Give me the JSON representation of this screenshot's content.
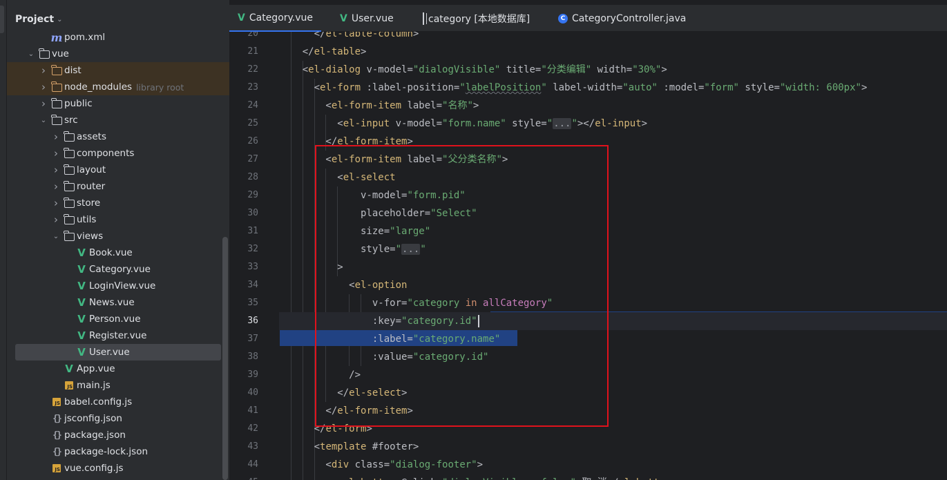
{
  "project": {
    "title": "Project",
    "tree": [
      {
        "label": "pom.xml",
        "icon": "maven-icon",
        "indent": 2,
        "arrow": "none"
      },
      {
        "label": "vue",
        "icon": "folder-icon",
        "indent": 1,
        "arrow": "down"
      },
      {
        "label": "dist",
        "icon": "folder-orange-icon",
        "indent": 2,
        "arrow": "right",
        "excluded": true
      },
      {
        "label": "node_modules",
        "hint": "library root",
        "icon": "folder-orange-icon",
        "indent": 2,
        "arrow": "right",
        "excluded": true
      },
      {
        "label": "public",
        "icon": "folder-icon",
        "indent": 2,
        "arrow": "right"
      },
      {
        "label": "src",
        "icon": "folder-icon",
        "indent": 2,
        "arrow": "down"
      },
      {
        "label": "assets",
        "icon": "folder-icon",
        "indent": 3,
        "arrow": "right"
      },
      {
        "label": "components",
        "icon": "folder-icon",
        "indent": 3,
        "arrow": "right"
      },
      {
        "label": "layout",
        "icon": "folder-icon",
        "indent": 3,
        "arrow": "right"
      },
      {
        "label": "router",
        "icon": "folder-icon",
        "indent": 3,
        "arrow": "right"
      },
      {
        "label": "store",
        "icon": "folder-icon",
        "indent": 3,
        "arrow": "right"
      },
      {
        "label": "utils",
        "icon": "folder-icon",
        "indent": 3,
        "arrow": "right"
      },
      {
        "label": "views",
        "icon": "folder-icon",
        "indent": 3,
        "arrow": "down"
      },
      {
        "label": "Book.vue",
        "icon": "vue-icon",
        "indent": 4,
        "arrow": "none"
      },
      {
        "label": "Category.vue",
        "icon": "vue-icon",
        "indent": 4,
        "arrow": "none"
      },
      {
        "label": "LoginView.vue",
        "icon": "vue-icon",
        "indent": 4,
        "arrow": "none"
      },
      {
        "label": "News.vue",
        "icon": "vue-icon",
        "indent": 4,
        "arrow": "none"
      },
      {
        "label": "Person.vue",
        "icon": "vue-icon",
        "indent": 4,
        "arrow": "none"
      },
      {
        "label": "Register.vue",
        "icon": "vue-icon",
        "indent": 4,
        "arrow": "none"
      },
      {
        "label": "User.vue",
        "icon": "vue-icon",
        "indent": 4,
        "arrow": "none",
        "selected": true
      },
      {
        "label": "App.vue",
        "icon": "vue-icon",
        "indent": 3,
        "arrow": "none"
      },
      {
        "label": "main.js",
        "icon": "js-icon",
        "indent": 3,
        "arrow": "none"
      },
      {
        "label": "babel.config.js",
        "icon": "js-icon",
        "indent": 2,
        "arrow": "none"
      },
      {
        "label": "jsconfig.json",
        "icon": "json-icon",
        "indent": 2,
        "arrow": "none"
      },
      {
        "label": "package.json",
        "icon": "json-icon",
        "indent": 2,
        "arrow": "none"
      },
      {
        "label": "package-lock.json",
        "icon": "json-icon",
        "indent": 2,
        "arrow": "none"
      },
      {
        "label": "vue.config.js",
        "icon": "js-icon",
        "indent": 2,
        "arrow": "none"
      }
    ]
  },
  "tabs": [
    {
      "label": "Category.vue",
      "icon": "vue-icon",
      "active": true
    },
    {
      "label": "User.vue",
      "icon": "vue-icon",
      "active": false
    },
    {
      "label": "category [本地数据库]",
      "icon": "table-icon",
      "active": false
    },
    {
      "label": "CategoryController.java",
      "icon": "class-icon",
      "active": false
    }
  ],
  "editor": {
    "current_line": 36,
    "lines": [
      {
        "n": "20",
        "tokens": [
          [
            "p",
            "      </"
          ],
          [
            "t",
            "el-table-column"
          ],
          [
            "p",
            ">"
          ]
        ]
      },
      {
        "n": "21",
        "tokens": [
          [
            "p",
            "    </"
          ],
          [
            "t",
            "el-table"
          ],
          [
            "p",
            ">"
          ]
        ]
      },
      {
        "n": "22",
        "tokens": [
          [
            "p",
            "    <"
          ],
          [
            "t",
            "el-dialog"
          ],
          [
            "a",
            " v-model="
          ],
          [
            "s",
            "\"dialogVisible\""
          ],
          [
            "a",
            " title="
          ],
          [
            "s",
            "\"分类编辑\""
          ],
          [
            "a",
            " width="
          ],
          [
            "s",
            "\"30%\""
          ],
          [
            "p",
            ">"
          ]
        ]
      },
      {
        "n": "23",
        "tokens": [
          [
            "p",
            "      <"
          ],
          [
            "t",
            "el-form"
          ],
          [
            "a",
            " :label-position="
          ],
          [
            "s",
            "\""
          ],
          [
            "ul",
            "labelPosition"
          ],
          [
            "s",
            "\""
          ],
          [
            "a",
            " label-width="
          ],
          [
            "s",
            "\"auto\""
          ],
          [
            "a",
            " :model="
          ],
          [
            "s",
            "\"form\""
          ],
          [
            "a",
            " style="
          ],
          [
            "s",
            "\"width: 600px\""
          ],
          [
            "p",
            ">"
          ]
        ]
      },
      {
        "n": "24",
        "tokens": [
          [
            "p",
            "        <"
          ],
          [
            "t",
            "el-form-item"
          ],
          [
            "a",
            " label="
          ],
          [
            "s",
            "\"名称\""
          ],
          [
            "p",
            ">"
          ]
        ]
      },
      {
        "n": "25",
        "tokens": [
          [
            "p",
            "          <"
          ],
          [
            "t",
            "el-input"
          ],
          [
            "a",
            " v-model="
          ],
          [
            "s",
            "\"form.name\""
          ],
          [
            "a",
            " style="
          ],
          [
            "s",
            "\""
          ],
          [
            "fold",
            "..."
          ],
          [
            "s",
            "\""
          ],
          [
            "p",
            "></"
          ],
          [
            "t",
            "el-input"
          ],
          [
            "p",
            ">"
          ]
        ]
      },
      {
        "n": "26",
        "tokens": [
          [
            "p",
            "        </"
          ],
          [
            "t",
            "el-form-item"
          ],
          [
            "p",
            ">"
          ]
        ]
      },
      {
        "n": "27",
        "tokens": [
          [
            "p",
            "        <"
          ],
          [
            "t",
            "el-form-item"
          ],
          [
            "a",
            " label="
          ],
          [
            "s",
            "\"父分类名称\""
          ],
          [
            "p",
            ">"
          ]
        ]
      },
      {
        "n": "28",
        "tokens": [
          [
            "p",
            "          <"
          ],
          [
            "t",
            "el-select"
          ]
        ]
      },
      {
        "n": "29",
        "tokens": [
          [
            "a",
            "              v-model="
          ],
          [
            "s",
            "\"form.pid\""
          ]
        ]
      },
      {
        "n": "30",
        "tokens": [
          [
            "a",
            "              placeholder="
          ],
          [
            "s",
            "\"Select\""
          ]
        ]
      },
      {
        "n": "31",
        "tokens": [
          [
            "a",
            "              size="
          ],
          [
            "s",
            "\"large\""
          ]
        ]
      },
      {
        "n": "32",
        "tokens": [
          [
            "a",
            "              style="
          ],
          [
            "s",
            "\""
          ],
          [
            "fold",
            "..."
          ],
          [
            "s",
            "\""
          ]
        ]
      },
      {
        "n": "33",
        "tokens": [
          [
            "p",
            "          >"
          ]
        ]
      },
      {
        "n": "34",
        "tokens": [
          [
            "p",
            "            <"
          ],
          [
            "t",
            "el-option"
          ]
        ]
      },
      {
        "n": "35",
        "tokens": [
          [
            "a",
            "                v-for="
          ],
          [
            "s",
            "\"category "
          ],
          [
            "k",
            "in"
          ],
          [
            "s",
            " "
          ],
          [
            "v",
            "allCategory"
          ],
          [
            "s",
            "\""
          ]
        ]
      },
      {
        "n": "36",
        "tokens": [
          [
            "a",
            "                :key="
          ],
          [
            "s",
            "\"category.id\""
          ],
          [
            "caret",
            ""
          ]
        ]
      },
      {
        "n": "37",
        "tokens": [
          [
            "a",
            "                :label="
          ],
          [
            "s",
            "\"category.name\""
          ]
        ]
      },
      {
        "n": "38",
        "tokens": [
          [
            "a",
            "                :value="
          ],
          [
            "s",
            "\"category.id\""
          ]
        ]
      },
      {
        "n": "39",
        "tokens": [
          [
            "p",
            "            />"
          ]
        ]
      },
      {
        "n": "40",
        "tokens": [
          [
            "p",
            "          </"
          ],
          [
            "t",
            "el-select"
          ],
          [
            "p",
            ">"
          ]
        ]
      },
      {
        "n": "41",
        "tokens": [
          [
            "p",
            "        </"
          ],
          [
            "t",
            "el-form-item"
          ],
          [
            "p",
            ">"
          ]
        ]
      },
      {
        "n": "42",
        "tokens": [
          [
            "p",
            "      </"
          ],
          [
            "t",
            "el-form"
          ],
          [
            "p",
            ">"
          ]
        ]
      },
      {
        "n": "43",
        "tokens": [
          [
            "p",
            "      <"
          ],
          [
            "t",
            "template"
          ],
          [
            "a",
            " #footer"
          ],
          [
            "p",
            ">"
          ]
        ]
      },
      {
        "n": "44",
        "tokens": [
          [
            "p",
            "        <"
          ],
          [
            "t",
            "div"
          ],
          [
            "a",
            " class="
          ],
          [
            "s",
            "\"dialog-footer\""
          ],
          [
            "p",
            ">"
          ]
        ]
      },
      {
        "n": "45",
        "tokens": [
          [
            "p",
            "          <"
          ],
          [
            "t",
            "el-button"
          ],
          [
            "a",
            " @click="
          ],
          [
            "s",
            "\"dialogVisible = false\""
          ],
          [
            "p",
            ">取 消</"
          ],
          [
            "t",
            "el-button"
          ],
          [
            "p",
            ">"
          ]
        ]
      }
    ]
  },
  "colors": {
    "accent": "#3574f0",
    "selection": "#214283",
    "highlight_box": "#e0121c",
    "tag": "#d5b778",
    "string": "#6aab73"
  }
}
